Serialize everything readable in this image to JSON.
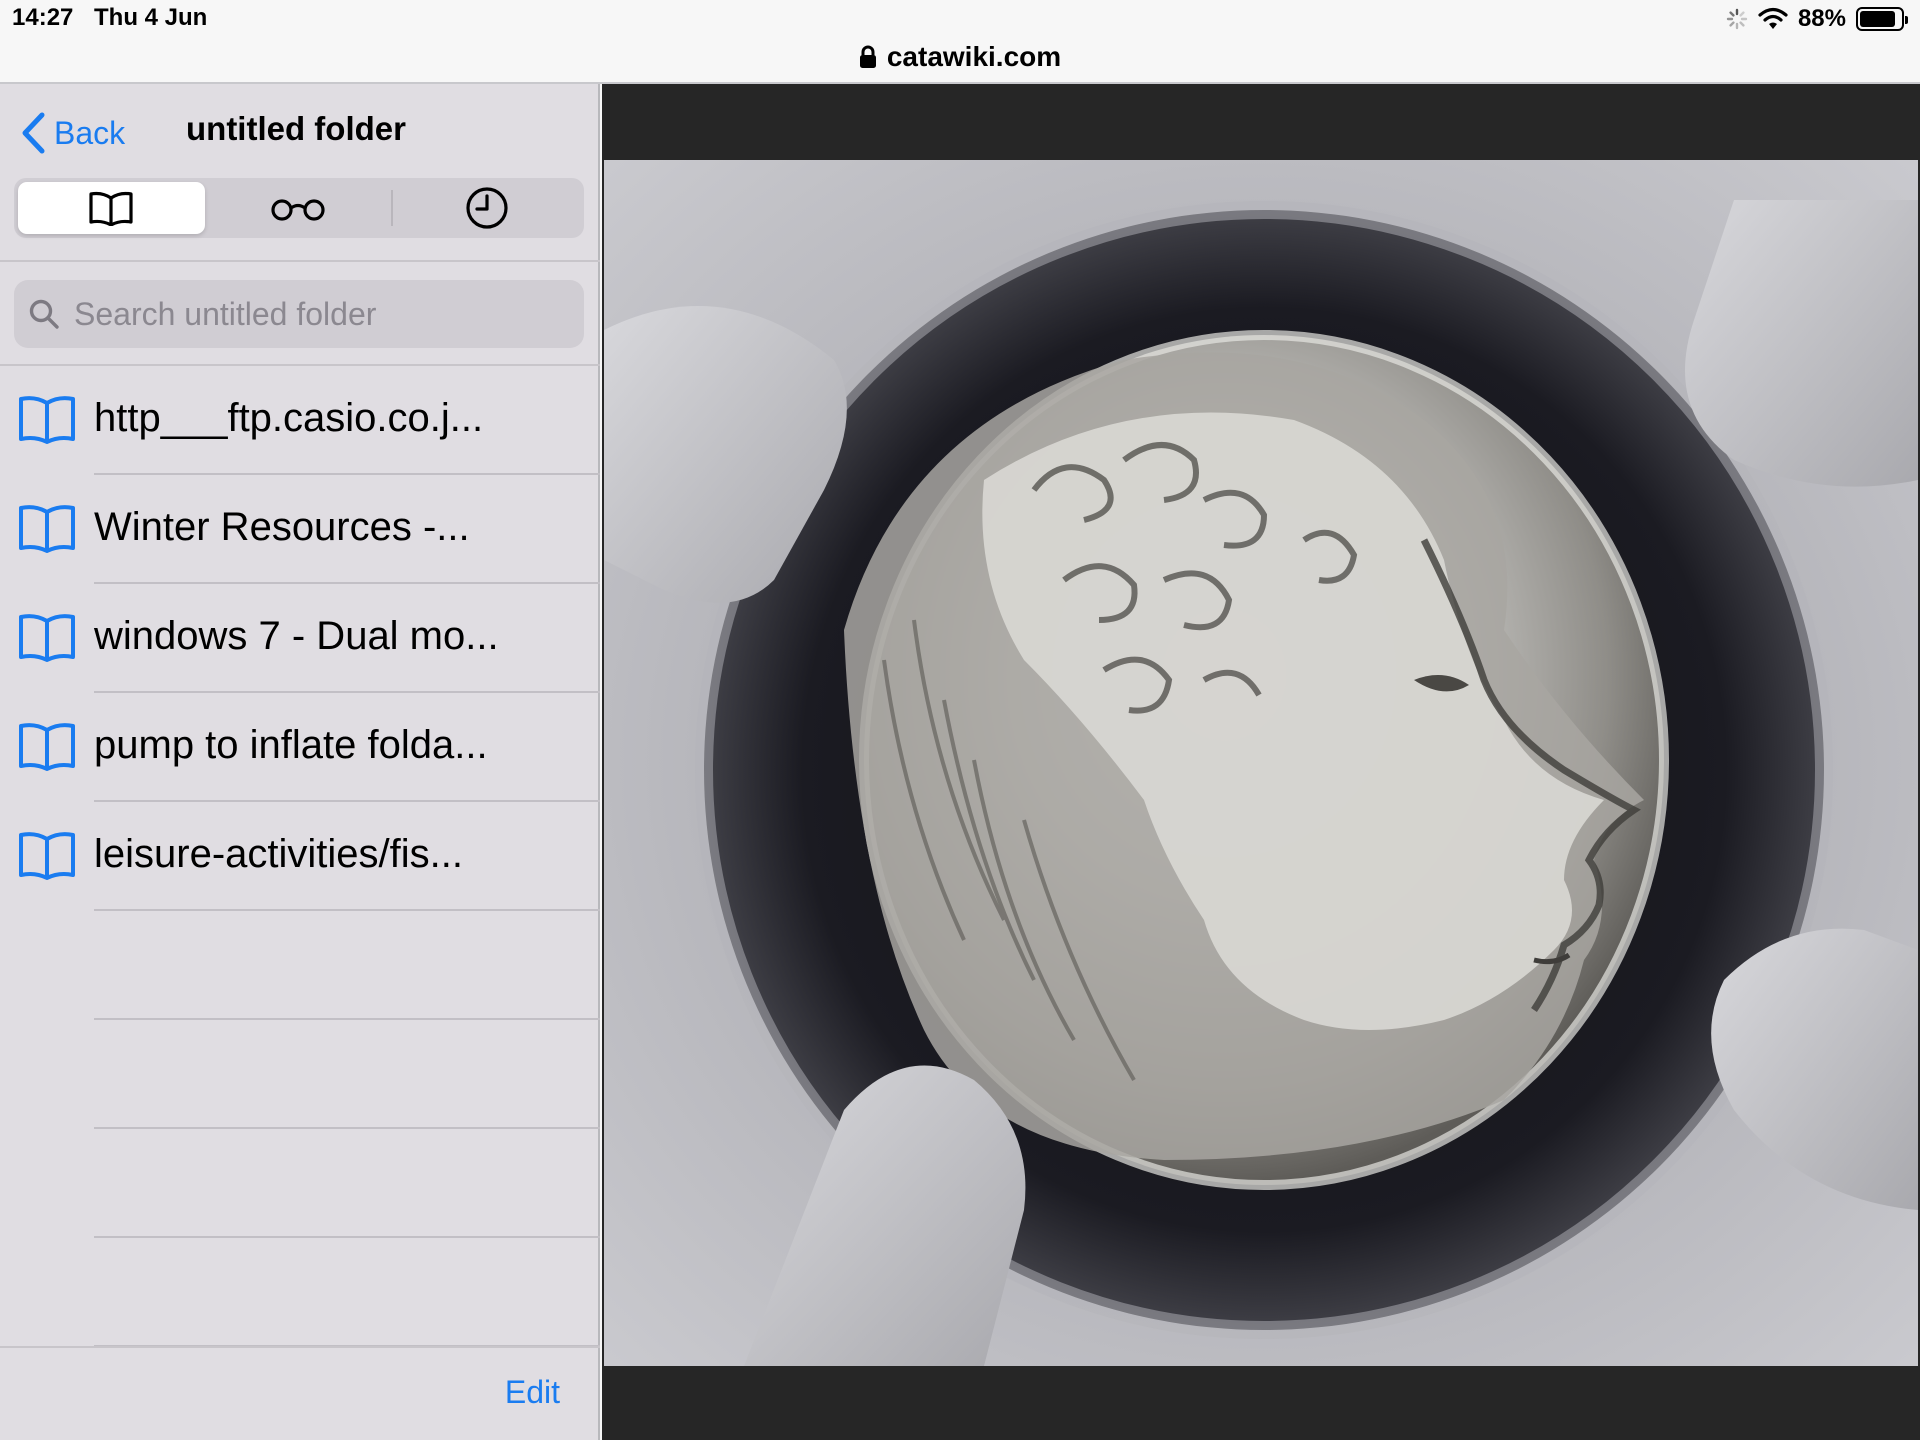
{
  "status": {
    "time": "14:27",
    "date": "Thu 4 Jun",
    "battery_pct": "88%",
    "battery_level": 0.88
  },
  "browser": {
    "url": "catawiki.com"
  },
  "sidebar": {
    "back_label": "Back",
    "title": "untitled folder",
    "tabs": [
      {
        "name": "bookmarks",
        "icon": "book-icon",
        "active": true
      },
      {
        "name": "reading-list",
        "icon": "glasses-icon",
        "active": false
      },
      {
        "name": "history",
        "icon": "clock-icon",
        "active": false
      }
    ],
    "search_placeholder": "Search untitled folder",
    "search_value": "",
    "bookmarks": [
      {
        "label": "http___ftp.casio.co.j..."
      },
      {
        "label": "Winter Resources -..."
      },
      {
        "label": "windows 7 - Dual mo..."
      },
      {
        "label": "pump to inflate folda..."
      },
      {
        "label": "leisure-activities/fis..."
      }
    ],
    "edit_label": "Edit"
  },
  "colors": {
    "accent": "#1a7cf0",
    "sidebar_bg": "#e0dde2",
    "content_bg": "#262626"
  }
}
